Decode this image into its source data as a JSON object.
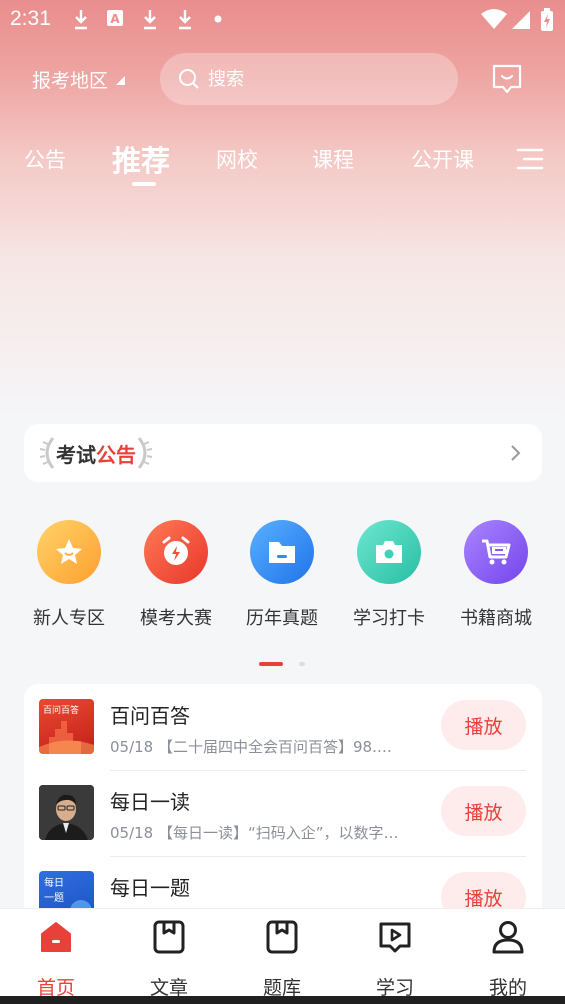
{
  "status_bar": {
    "time": "2:31",
    "icons": [
      "download-icon",
      "a-badge-icon",
      "download-icon",
      "download-icon",
      "dot-icon",
      "wifi-icon",
      "signal-icon",
      "battery-icon"
    ]
  },
  "header": {
    "region_label": "报考地区",
    "search_placeholder": "搜索",
    "message_icon": "message-icon"
  },
  "tabs": [
    {
      "label": "公告",
      "active": false
    },
    {
      "label": "推荐",
      "active": true
    },
    {
      "label": "网校",
      "active": false
    },
    {
      "label": "课程",
      "active": false
    },
    {
      "label": "公开课",
      "active": false
    }
  ],
  "notice": {
    "title_part1": "考试",
    "title_part2": "公告"
  },
  "quick_links": [
    {
      "label": "新人专区",
      "icon": "star-badge-icon",
      "color": "#ffb640"
    },
    {
      "label": "模考大赛",
      "icon": "alarm-bolt-icon",
      "color": "#f0503a"
    },
    {
      "label": "历年真题",
      "icon": "folder-icon",
      "color": "#2f8cf0"
    },
    {
      "label": "学习打卡",
      "icon": "camera-icon",
      "color": "#3fd0b8"
    },
    {
      "label": "书籍商城",
      "icon": "cart-icon",
      "color": "#8a5cf5"
    }
  ],
  "list": [
    {
      "title": "百问百答",
      "desc": "05/18 【二十届四中全会百问百答】98.…",
      "button": "播放",
      "thumb_text": "百问百答"
    },
    {
      "title": "每日一读",
      "desc": "05/18 【每日一读】“扫码入企”，以数字…",
      "button": "播放",
      "thumb_text": ""
    },
    {
      "title": "每日一题",
      "desc": "",
      "button": "播放",
      "thumb_text": "每日一题"
    }
  ],
  "bottom_nav": [
    {
      "label": "首页",
      "icon": "home-icon",
      "active": true
    },
    {
      "label": "文章",
      "icon": "article-icon",
      "active": false
    },
    {
      "label": "题库",
      "icon": "question-bank-icon",
      "active": false
    },
    {
      "label": "学习",
      "icon": "play-study-icon",
      "active": false
    },
    {
      "label": "我的",
      "icon": "person-icon",
      "active": false
    }
  ],
  "colors": {
    "accent": "#e8413a",
    "hero_top": "#e98d8d",
    "background": "#f5f6f8"
  }
}
